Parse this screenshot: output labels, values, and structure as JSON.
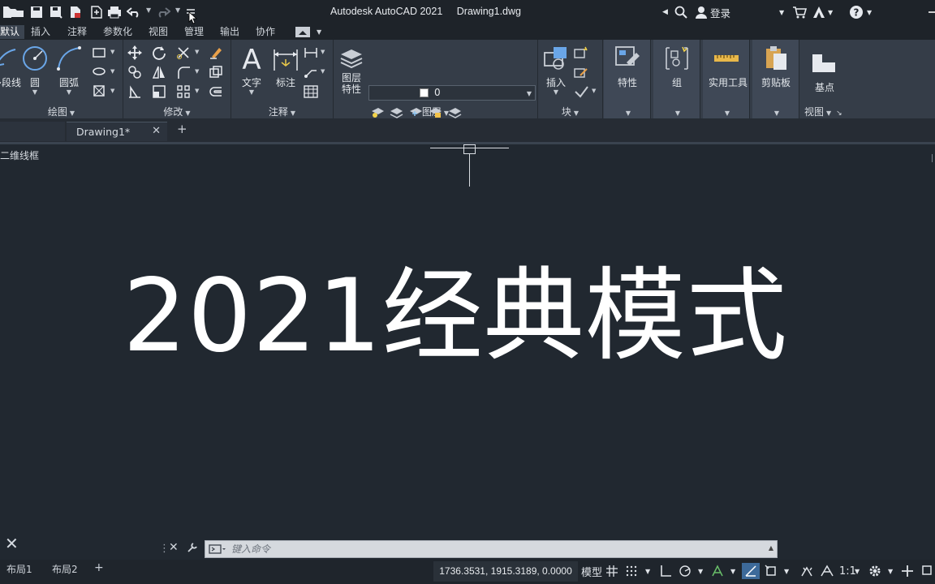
{
  "app": {
    "title": "Autodesk AutoCAD 2021",
    "document": "Drawing1.dwg",
    "login_label": "登录"
  },
  "ribbon_tabs": [
    {
      "label": "默认",
      "active": true
    },
    {
      "label": "插入"
    },
    {
      "label": "注释"
    },
    {
      "label": "参数化"
    },
    {
      "label": "视图"
    },
    {
      "label": "管理"
    },
    {
      "label": "输出"
    },
    {
      "label": "协作"
    }
  ],
  "panels": {
    "draw": {
      "title": "绘图",
      "buttons": [
        "多段线",
        "圆",
        "圆弧"
      ]
    },
    "modify": {
      "title": "修改"
    },
    "annotation": {
      "title": "注释",
      "buttons": [
        "文字",
        "标注"
      ]
    },
    "layers": {
      "title": "图层",
      "button": "图层\n特性",
      "current_layer": "0"
    },
    "block": {
      "title": "块",
      "button": "插入"
    },
    "properties": {
      "button": "特性"
    },
    "groups": {
      "button": "组"
    },
    "utilities": {
      "button": "实用工具"
    },
    "clipboard": {
      "button": "剪贴板"
    },
    "view": {
      "title": "视图",
      "button": "基点"
    }
  },
  "doc_tabs": [
    {
      "label": "Drawing1*",
      "active": true
    }
  ],
  "viewport_label": "二维线框",
  "canvas_caption": "2021经典模式",
  "command_line": {
    "placeholder": "键入命令"
  },
  "layout_tabs": [
    "布局1",
    "布局2"
  ],
  "status": {
    "coordinates": "1736.3531, 1915.3189, 0.0000",
    "model_label": "模型",
    "scale": "1:1"
  },
  "colors": {
    "canvas": "#212830",
    "ribbon": "#353d48",
    "accent": "#3d6a9a"
  }
}
